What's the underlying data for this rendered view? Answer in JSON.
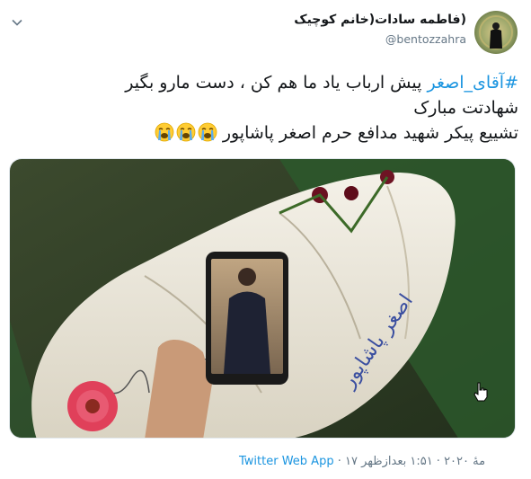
{
  "author": {
    "display_name": "(فاطمه سادات(خانم کوچیک",
    "handle": "@bentozzahra"
  },
  "tweet": {
    "hashtag": "#آقای_اصغر",
    "line1_rest": " پیش ارباب یاد ما هم کن ، دست مارو بگیر",
    "line2": "شهادتت مبارک",
    "line3": "تشییع پیکر شهید مدافع حرم اصغر پاشاپور",
    "emoji_name": "loudly-crying-face",
    "emoji_count": 3
  },
  "media": {
    "description_icon": "photo-of-shrouded-coffin-with-phone-photo",
    "shroud_writing": "اصغر پاشاپور"
  },
  "footer": {
    "time": "۱:۵۱ بعدازظهر",
    "separator": " · ",
    "date": "۱۷ مهٔ ۲۰۲۰",
    "source": "Twitter Web App"
  },
  "colors": {
    "link": "#1b95e0",
    "text": "#14171a",
    "muted": "#657786"
  }
}
